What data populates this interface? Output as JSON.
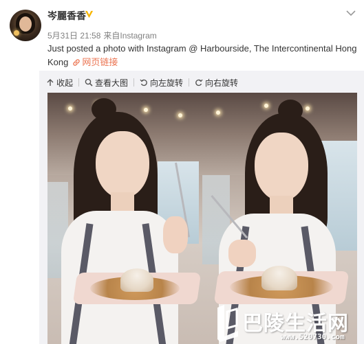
{
  "post": {
    "username": "岑麗香香",
    "date": "5月31日 21:58",
    "source_prefix": "来自",
    "source": "Instagram",
    "text": "Just posted a photo with Instagram @ Harbourside, The Intercontinental Hong Kong",
    "link_label": "网页链接"
  },
  "toolbar": {
    "collapse": "收起",
    "view_large": "查看大图",
    "rotate_left": "向左旋转",
    "rotate_right": "向右旋转"
  },
  "watermark": {
    "text": "巴陵生活网",
    "url": "www.520730.com"
  },
  "icons": {
    "verified": "verified-badge-icon",
    "chevron": "chevron-down-icon",
    "link": "link-icon",
    "collapse": "arrow-up-icon",
    "zoom": "magnifier-icon",
    "rotate_left": "rotate-left-icon",
    "rotate_right": "rotate-right-icon"
  },
  "colors": {
    "link_orange": "#eb7350",
    "verified_gold": "#f7b500",
    "meta_gray": "#808080",
    "toolbar_bg": "#f2f2f5"
  }
}
